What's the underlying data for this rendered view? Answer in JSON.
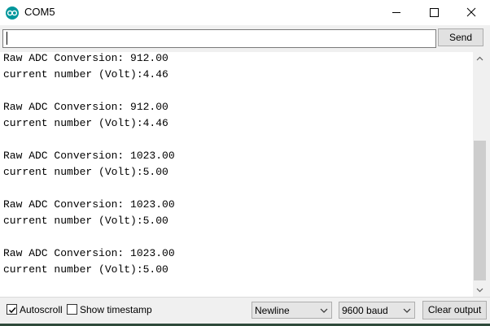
{
  "window": {
    "title": "COM5",
    "icon": "arduino-logo-icon",
    "controls": [
      "minimize-icon",
      "maximize-icon",
      "close-icon"
    ]
  },
  "input": {
    "value": "",
    "send_label": "Send"
  },
  "output": {
    "lines": [
      "Raw ADC Conversion: 912.00",
      "current number (Volt):4.46",
      "",
      "Raw ADC Conversion: 912.00",
      "current number (Volt):4.46",
      "",
      "Raw ADC Conversion: 1023.00",
      "current number (Volt):5.00",
      "",
      "Raw ADC Conversion: 1023.00",
      "current number (Volt):5.00",
      "",
      "Raw ADC Conversion: 1023.00",
      "current number (Volt):5.00"
    ]
  },
  "bottom": {
    "autoscroll_label": "Autoscroll",
    "autoscroll_checked": true,
    "timestamp_label": "Show timestamp",
    "timestamp_checked": false,
    "line_ending": "Newline",
    "baud_rate": "9600 baud",
    "clear_label": "Clear output"
  },
  "colors": {
    "accent": "#00979c",
    "thumb": "#cdcdcd"
  }
}
